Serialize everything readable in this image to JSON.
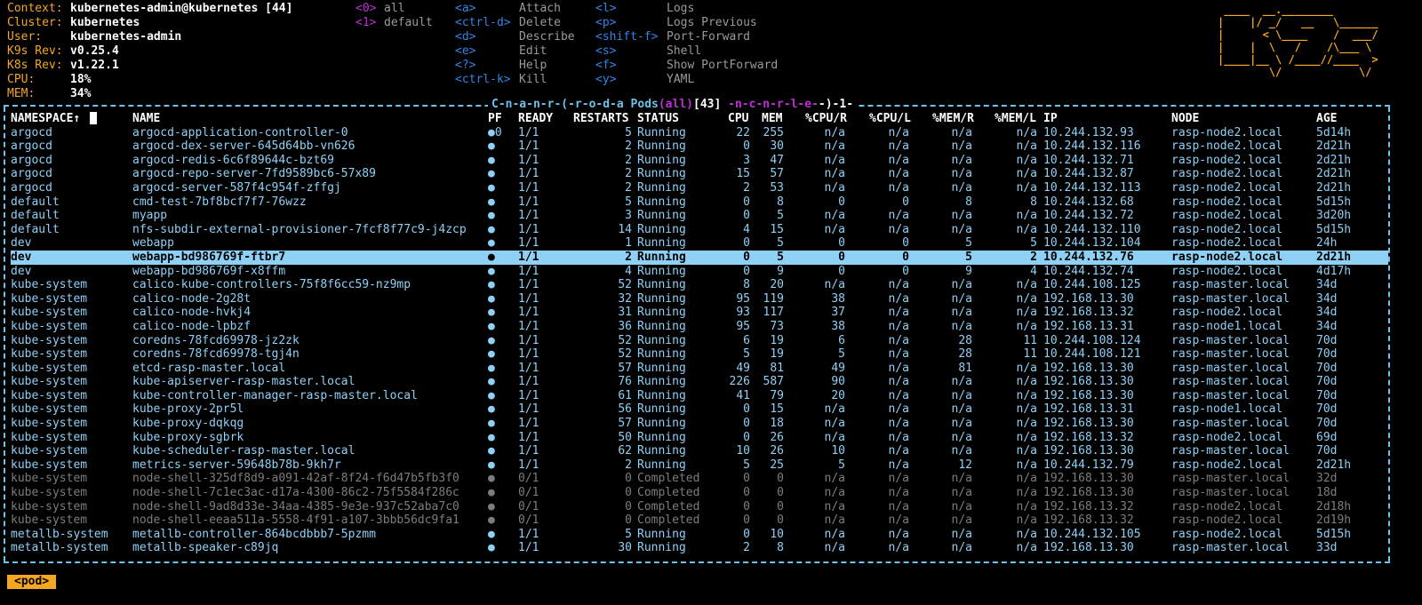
{
  "context": [
    {
      "key": "Context:",
      "value": "kubernetes-admin@kubernetes [44]"
    },
    {
      "key": "Cluster:",
      "value": "kubernetes"
    },
    {
      "key": "User:",
      "value": "kubernetes-admin"
    },
    {
      "key": "K9s Rev:",
      "value": "v0.25.4"
    },
    {
      "key": "K8s Rev:",
      "value": "v1.22.1"
    },
    {
      "key": "CPU:",
      "value": "18%"
    },
    {
      "key": "MEM:",
      "value": "34%"
    }
  ],
  "namespaces": [
    {
      "key": "<0>",
      "label": "all"
    },
    {
      "key": "<1>",
      "label": "default"
    }
  ],
  "hints_col1": [
    {
      "key": "<a>",
      "label": "Attach"
    },
    {
      "key": "<ctrl-d>",
      "label": "Delete"
    },
    {
      "key": "<d>",
      "label": "Describe"
    },
    {
      "key": "<e>",
      "label": "Edit"
    },
    {
      "key": "<?>",
      "label": "Help"
    },
    {
      "key": "<ctrl-k>",
      "label": "Kill"
    }
  ],
  "hints_col2": [
    {
      "key": "<l>",
      "label": "Logs"
    },
    {
      "key": "<p>",
      "label": "Logs Previous"
    },
    {
      "key": "<shift-f>",
      "label": "Port-Forward"
    },
    {
      "key": "<s>",
      "label": "Shell"
    },
    {
      "key": "<f>",
      "label": "Show PortForward"
    },
    {
      "key": "<y>",
      "label": "YAML"
    }
  ],
  "logo_text": "K9s",
  "title": {
    "sort_hint": "C-n-a-n-r-(-r-o-d-a",
    "resource": "Pods",
    "scope": "(all)",
    "count": "[43]",
    "sort_hint2": "-n-c-n-r-l-e-",
    "tail": "-)-1-"
  },
  "columns": [
    "NAMESPACE↑",
    "NAME",
    "PF",
    "READY",
    "RESTARTS",
    "STATUS",
    "CPU",
    "MEM",
    "%CPU/R",
    "%CPU/L",
    "%MEM/R",
    "%MEM/L",
    "IP",
    "NODE",
    "AGE"
  ],
  "rows": [
    {
      "ns": "argocd",
      "name": "argocd-application-controller-0",
      "pf": "●0",
      "ready": "1/1",
      "restarts": "5",
      "status": "Running",
      "cpu": "22",
      "mem": "255",
      "cpur": "n/a",
      "cpul": "n/a",
      "memr": "n/a",
      "meml": "n/a",
      "ip": "10.244.132.93",
      "node": "rasp-node2.local",
      "age": "5d14h"
    },
    {
      "ns": "argocd",
      "name": "argocd-dex-server-645d64bb-vn626",
      "pf": "●",
      "ready": "1/1",
      "restarts": "2",
      "status": "Running",
      "cpu": "0",
      "mem": "30",
      "cpur": "n/a",
      "cpul": "n/a",
      "memr": "n/a",
      "meml": "n/a",
      "ip": "10.244.132.116",
      "node": "rasp-node2.local",
      "age": "2d21h"
    },
    {
      "ns": "argocd",
      "name": "argocd-redis-6c6f89644c-bzt69",
      "pf": "●",
      "ready": "1/1",
      "restarts": "2",
      "status": "Running",
      "cpu": "3",
      "mem": "47",
      "cpur": "n/a",
      "cpul": "n/a",
      "memr": "n/a",
      "meml": "n/a",
      "ip": "10.244.132.71",
      "node": "rasp-node2.local",
      "age": "2d21h"
    },
    {
      "ns": "argocd",
      "name": "argocd-repo-server-7fd9589bc6-57x89",
      "pf": "●",
      "ready": "1/1",
      "restarts": "2",
      "status": "Running",
      "cpu": "15",
      "mem": "57",
      "cpur": "n/a",
      "cpul": "n/a",
      "memr": "n/a",
      "meml": "n/a",
      "ip": "10.244.132.87",
      "node": "rasp-node2.local",
      "age": "2d21h"
    },
    {
      "ns": "argocd",
      "name": "argocd-server-587f4c954f-zffgj",
      "pf": "●",
      "ready": "1/1",
      "restarts": "2",
      "status": "Running",
      "cpu": "2",
      "mem": "53",
      "cpur": "n/a",
      "cpul": "n/a",
      "memr": "n/a",
      "meml": "n/a",
      "ip": "10.244.132.113",
      "node": "rasp-node2.local",
      "age": "2d21h"
    },
    {
      "ns": "default",
      "name": "cmd-test-7bf8bcf7f7-76wzz",
      "pf": "●",
      "ready": "1/1",
      "restarts": "5",
      "status": "Running",
      "cpu": "0",
      "mem": "8",
      "cpur": "0",
      "cpul": "0",
      "memr": "8",
      "meml": "8",
      "ip": "10.244.132.68",
      "node": "rasp-node2.local",
      "age": "5d15h"
    },
    {
      "ns": "default",
      "name": "myapp",
      "pf": "●",
      "ready": "1/1",
      "restarts": "3",
      "status": "Running",
      "cpu": "0",
      "mem": "5",
      "cpur": "n/a",
      "cpul": "n/a",
      "memr": "n/a",
      "meml": "n/a",
      "ip": "10.244.132.72",
      "node": "rasp-node2.local",
      "age": "3d20h"
    },
    {
      "ns": "default",
      "name": "nfs-subdir-external-provisioner-7fcf8f77c9-j4zcp",
      "pf": "●",
      "ready": "1/1",
      "restarts": "14",
      "status": "Running",
      "cpu": "4",
      "mem": "15",
      "cpur": "n/a",
      "cpul": "n/a",
      "memr": "n/a",
      "meml": "n/a",
      "ip": "10.244.132.110",
      "node": "rasp-node2.local",
      "age": "5d15h"
    },
    {
      "ns": "dev",
      "name": "webapp",
      "pf": "●",
      "ready": "1/1",
      "restarts": "1",
      "status": "Running",
      "cpu": "0",
      "mem": "5",
      "cpur": "0",
      "cpul": "0",
      "memr": "5",
      "meml": "5",
      "ip": "10.244.132.104",
      "node": "rasp-node2.local",
      "age": "24h"
    },
    {
      "ns": "dev",
      "name": "webapp-bd986769f-ftbr7",
      "pf": "●",
      "ready": "1/1",
      "restarts": "2",
      "status": "Running",
      "cpu": "0",
      "mem": "5",
      "cpur": "0",
      "cpul": "0",
      "memr": "5",
      "meml": "2",
      "ip": "10.244.132.76",
      "node": "rasp-node2.local",
      "age": "2d21h",
      "selected": true
    },
    {
      "ns": "dev",
      "name": "webapp-bd986769f-x8ffm",
      "pf": "●",
      "ready": "1/1",
      "restarts": "4",
      "status": "Running",
      "cpu": "0",
      "mem": "9",
      "cpur": "0",
      "cpul": "0",
      "memr": "9",
      "meml": "4",
      "ip": "10.244.132.74",
      "node": "rasp-node2.local",
      "age": "4d17h"
    },
    {
      "ns": "kube-system",
      "name": "calico-kube-controllers-75f8f6cc59-nz9mp",
      "pf": "●",
      "ready": "1/1",
      "restarts": "52",
      "status": "Running",
      "cpu": "8",
      "mem": "20",
      "cpur": "n/a",
      "cpul": "n/a",
      "memr": "n/a",
      "meml": "n/a",
      "ip": "10.244.108.125",
      "node": "rasp-master.local",
      "age": "34d"
    },
    {
      "ns": "kube-system",
      "name": "calico-node-2g28t",
      "pf": "●",
      "ready": "1/1",
      "restarts": "32",
      "status": "Running",
      "cpu": "95",
      "mem": "119",
      "cpur": "38",
      "cpul": "n/a",
      "memr": "n/a",
      "meml": "n/a",
      "ip": "192.168.13.30",
      "node": "rasp-master.local",
      "age": "34d"
    },
    {
      "ns": "kube-system",
      "name": "calico-node-hvkj4",
      "pf": "●",
      "ready": "1/1",
      "restarts": "31",
      "status": "Running",
      "cpu": "93",
      "mem": "117",
      "cpur": "37",
      "cpul": "n/a",
      "memr": "n/a",
      "meml": "n/a",
      "ip": "192.168.13.32",
      "node": "rasp-node2.local",
      "age": "34d"
    },
    {
      "ns": "kube-system",
      "name": "calico-node-lpbzf",
      "pf": "●",
      "ready": "1/1",
      "restarts": "36",
      "status": "Running",
      "cpu": "95",
      "mem": "73",
      "cpur": "38",
      "cpul": "n/a",
      "memr": "n/a",
      "meml": "n/a",
      "ip": "192.168.13.31",
      "node": "rasp-node1.local",
      "age": "34d"
    },
    {
      "ns": "kube-system",
      "name": "coredns-78fcd69978-jz2zk",
      "pf": "●",
      "ready": "1/1",
      "restarts": "52",
      "status": "Running",
      "cpu": "6",
      "mem": "19",
      "cpur": "6",
      "cpul": "n/a",
      "memr": "28",
      "meml": "11",
      "ip": "10.244.108.124",
      "node": "rasp-master.local",
      "age": "70d"
    },
    {
      "ns": "kube-system",
      "name": "coredns-78fcd69978-tgj4n",
      "pf": "●",
      "ready": "1/1",
      "restarts": "52",
      "status": "Running",
      "cpu": "5",
      "mem": "19",
      "cpur": "5",
      "cpul": "n/a",
      "memr": "28",
      "meml": "11",
      "ip": "10.244.108.121",
      "node": "rasp-master.local",
      "age": "70d"
    },
    {
      "ns": "kube-system",
      "name": "etcd-rasp-master.local",
      "pf": "●",
      "ready": "1/1",
      "restarts": "57",
      "status": "Running",
      "cpu": "49",
      "mem": "81",
      "cpur": "49",
      "cpul": "n/a",
      "memr": "81",
      "meml": "n/a",
      "ip": "192.168.13.30",
      "node": "rasp-master.local",
      "age": "70d"
    },
    {
      "ns": "kube-system",
      "name": "kube-apiserver-rasp-master.local",
      "pf": "●",
      "ready": "1/1",
      "restarts": "76",
      "status": "Running",
      "cpu": "226",
      "mem": "587",
      "cpur": "90",
      "cpul": "n/a",
      "memr": "n/a",
      "meml": "n/a",
      "ip": "192.168.13.30",
      "node": "rasp-master.local",
      "age": "70d"
    },
    {
      "ns": "kube-system",
      "name": "kube-controller-manager-rasp-master.local",
      "pf": "●",
      "ready": "1/1",
      "restarts": "61",
      "status": "Running",
      "cpu": "41",
      "mem": "79",
      "cpur": "20",
      "cpul": "n/a",
      "memr": "n/a",
      "meml": "n/a",
      "ip": "192.168.13.30",
      "node": "rasp-master.local",
      "age": "70d"
    },
    {
      "ns": "kube-system",
      "name": "kube-proxy-2pr5l",
      "pf": "●",
      "ready": "1/1",
      "restarts": "56",
      "status": "Running",
      "cpu": "0",
      "mem": "15",
      "cpur": "n/a",
      "cpul": "n/a",
      "memr": "n/a",
      "meml": "n/a",
      "ip": "192.168.13.31",
      "node": "rasp-node1.local",
      "age": "70d"
    },
    {
      "ns": "kube-system",
      "name": "kube-proxy-dqkqg",
      "pf": "●",
      "ready": "1/1",
      "restarts": "57",
      "status": "Running",
      "cpu": "0",
      "mem": "18",
      "cpur": "n/a",
      "cpul": "n/a",
      "memr": "n/a",
      "meml": "n/a",
      "ip": "192.168.13.30",
      "node": "rasp-master.local",
      "age": "70d"
    },
    {
      "ns": "kube-system",
      "name": "kube-proxy-sgbrk",
      "pf": "●",
      "ready": "1/1",
      "restarts": "50",
      "status": "Running",
      "cpu": "0",
      "mem": "26",
      "cpur": "n/a",
      "cpul": "n/a",
      "memr": "n/a",
      "meml": "n/a",
      "ip": "192.168.13.32",
      "node": "rasp-node2.local",
      "age": "69d"
    },
    {
      "ns": "kube-system",
      "name": "kube-scheduler-rasp-master.local",
      "pf": "●",
      "ready": "1/1",
      "restarts": "62",
      "status": "Running",
      "cpu": "10",
      "mem": "26",
      "cpur": "10",
      "cpul": "n/a",
      "memr": "n/a",
      "meml": "n/a",
      "ip": "192.168.13.30",
      "node": "rasp-master.local",
      "age": "70d"
    },
    {
      "ns": "kube-system",
      "name": "metrics-server-59648b78b-9kh7r",
      "pf": "●",
      "ready": "1/1",
      "restarts": "2",
      "status": "Running",
      "cpu": "5",
      "mem": "25",
      "cpur": "5",
      "cpul": "n/a",
      "memr": "12",
      "meml": "n/a",
      "ip": "10.244.132.79",
      "node": "rasp-node2.local",
      "age": "2d21h"
    },
    {
      "ns": "kube-system",
      "name": "node-shell-325df8d9-a091-42af-8f24-f6d47b5fb3f0",
      "pf": "●",
      "ready": "0/1",
      "restarts": "0",
      "status": "Completed",
      "cpu": "0",
      "mem": "0",
      "cpur": "n/a",
      "cpul": "n/a",
      "memr": "n/a",
      "meml": "n/a",
      "ip": "192.168.13.30",
      "node": "rasp-master.local",
      "age": "32d",
      "completed": true
    },
    {
      "ns": "kube-system",
      "name": "node-shell-7c1ec3ac-d17a-4300-86c2-75f5584f286c",
      "pf": "●",
      "ready": "0/1",
      "restarts": "0",
      "status": "Completed",
      "cpu": "0",
      "mem": "0",
      "cpur": "n/a",
      "cpul": "n/a",
      "memr": "n/a",
      "meml": "n/a",
      "ip": "192.168.13.30",
      "node": "rasp-master.local",
      "age": "18d",
      "completed": true
    },
    {
      "ns": "kube-system",
      "name": "node-shell-9ad8d33e-34aa-4385-9e3e-937c52aba7c0",
      "pf": "●",
      "ready": "0/1",
      "restarts": "0",
      "status": "Completed",
      "cpu": "0",
      "mem": "0",
      "cpur": "n/a",
      "cpul": "n/a",
      "memr": "n/a",
      "meml": "n/a",
      "ip": "192.168.13.32",
      "node": "rasp-node2.local",
      "age": "2d18h",
      "completed": true
    },
    {
      "ns": "kube-system",
      "name": "node-shell-eeaa511a-5558-4f91-a107-3bbb56dc9fa1",
      "pf": "●",
      "ready": "0/1",
      "restarts": "0",
      "status": "Completed",
      "cpu": "0",
      "mem": "0",
      "cpur": "n/a",
      "cpul": "n/a",
      "memr": "n/a",
      "meml": "n/a",
      "ip": "192.168.13.32",
      "node": "rasp-node2.local",
      "age": "2d19h",
      "completed": true
    },
    {
      "ns": "metallb-system",
      "name": "metallb-controller-864bcdbbb7-5pzmm",
      "pf": "●",
      "ready": "1/1",
      "restarts": "5",
      "status": "Running",
      "cpu": "0",
      "mem": "10",
      "cpur": "n/a",
      "cpul": "n/a",
      "memr": "n/a",
      "meml": "n/a",
      "ip": "10.244.132.105",
      "node": "rasp-node2.local",
      "age": "5d15h"
    },
    {
      "ns": "metallb-system",
      "name": "metallb-speaker-c89jq",
      "pf": "●",
      "ready": "1/1",
      "restarts": "30",
      "status": "Running",
      "cpu": "2",
      "mem": "8",
      "cpur": "n/a",
      "cpul": "n/a",
      "memr": "n/a",
      "meml": "n/a",
      "ip": "192.168.13.30",
      "node": "rasp-master.local",
      "age": "33d"
    }
  ],
  "breadcrumb": "<pod>",
  "colors": {
    "accent": "#f5a623",
    "row": "#8fd0f5",
    "selected_bg": "#8fd0f5",
    "key": "#2f86e8",
    "ns_key": "#c02cd8",
    "frame": "#6ec1e8"
  }
}
